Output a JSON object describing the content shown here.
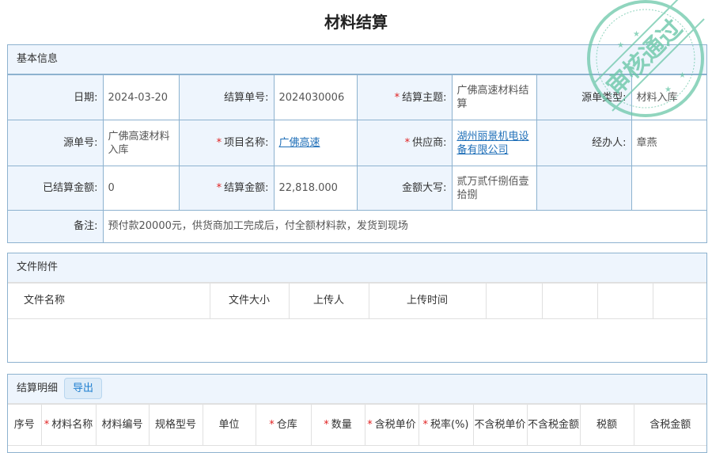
{
  "title": "材料结算",
  "stamp_text": "审核通过",
  "basic": {
    "header": "基本信息",
    "date_label": "日期:",
    "date": "2024-03-20",
    "no_label": "结算单号:",
    "no": "2024030006",
    "subject_label": "结算主题:",
    "subject": "广佛高速材料结算",
    "source_type_label": "源单类型:",
    "source_type": "材料入库",
    "source_no_label": "源单号:",
    "source_no": "广佛高速材料入库",
    "project_label": "项目名称:",
    "project": "广佛高速",
    "supplier_label": "供应商:",
    "supplier": "湖州丽景机电设备有限公司",
    "handler_label": "经办人:",
    "handler": "章燕",
    "settled_label": "已结算金额:",
    "settled": "0",
    "amount_label": "结算金额:",
    "amount": "22,818.000",
    "amount_cn_label": "金额大写:",
    "amount_cn": "贰万贰仟捌佰壹拾捌",
    "remark_label": "备注:",
    "remark": "预付款20000元，供货商加工完成后，付全额材料款，发货到现场"
  },
  "attachments": {
    "header": "文件附件",
    "columns": [
      "文件名称",
      "文件大小",
      "上传人",
      "上传时间"
    ]
  },
  "details": {
    "header": "结算明细",
    "export_label": "导出",
    "columns": [
      {
        "label": "序号",
        "required": false
      },
      {
        "label": "材料名称",
        "required": true
      },
      {
        "label": "材料编号",
        "required": false
      },
      {
        "label": "规格型号",
        "required": false
      },
      {
        "label": "单位",
        "required": false
      },
      {
        "label": "仓库",
        "required": true
      },
      {
        "label": "数量",
        "required": true
      },
      {
        "label": "含税单价",
        "required": true
      },
      {
        "label": "税率(%)",
        "required": true
      },
      {
        "label": "不含税单价",
        "required": false
      },
      {
        "label": "不含税金额",
        "required": false
      },
      {
        "label": "税额",
        "required": false
      },
      {
        "label": "含税金额",
        "required": false
      }
    ]
  },
  "colors": {
    "border": "#8db2cf",
    "label_bg": "#eef5fd",
    "link": "#1f6fb8",
    "required": "#e02020",
    "stamp": "#6cc7a9"
  }
}
